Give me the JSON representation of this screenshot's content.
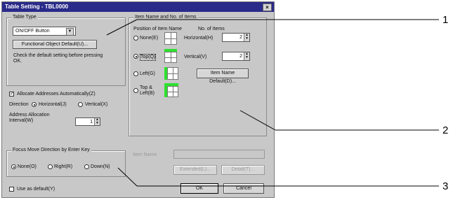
{
  "dialog": {
    "title": "Table Setting - TBL0000",
    "close_label": "×"
  },
  "table_type": {
    "group_label": "Table Type",
    "select_value": "ON/OFF Button",
    "default_button": "Functional Object Default(U)...",
    "info_text": "Check the default setting before pressing OK."
  },
  "allocate": {
    "label": "Allocate Addresses Automatically(Z)",
    "checked": true
  },
  "direction": {
    "label": "Direction",
    "options": [
      "Horizontal(J)",
      "Vertical(X)"
    ],
    "selected": 0
  },
  "address_interval": {
    "label": "Address Allocation Interval(W)",
    "value": "1"
  },
  "item_name": {
    "group_label": "Item Name and No. of Items",
    "position_label": "Position of Item Name",
    "items_label": "No. of Items",
    "positions": [
      "None(E)",
      "Top(Q)",
      "Left(G)",
      "Top & Left(B)"
    ],
    "selected_position": 1,
    "horizontal_label": "Horizontal(H)",
    "horizontal_value": "2",
    "vertical_label": "Vertical(V)",
    "vertical_value": "2",
    "default_button": "Item Name Default(D)..."
  },
  "focus": {
    "group_label": "Focus Move Direction by Enter Key",
    "options": [
      "None(O)",
      "Right(R)",
      "Down(N)"
    ],
    "selected": 0
  },
  "item_name_field": {
    "label": "Item Name",
    "value": ""
  },
  "disabled_buttons": [
    "Extended(L)...",
    "Detail(T)..."
  ],
  "use_default": {
    "label": "Use as default(Y)",
    "checked": false
  },
  "footer": {
    "ok": "OK",
    "cancel": "Cancel"
  },
  "callouts": [
    "1",
    "2",
    "3"
  ],
  "colors": {
    "titlebar": "#2a2a8a",
    "dialog_bg": "#c8c8c8",
    "highlight_green": "#2ee02e"
  }
}
